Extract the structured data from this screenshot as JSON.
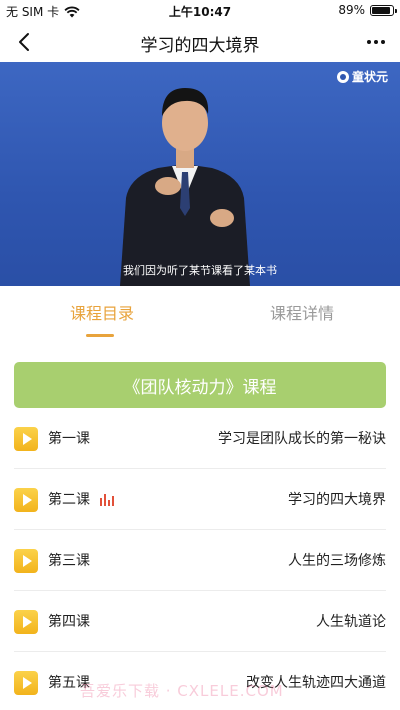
{
  "status_bar": {
    "carrier": "无 SIM 卡",
    "time": "上午10:47",
    "battery": "89%",
    "battery_level": 0.89
  },
  "nav": {
    "title": "学习的四大境界"
  },
  "video": {
    "logo_text": "童状元",
    "subtitle": "我们因为听了某节课看了某本书"
  },
  "tabs": {
    "catalog": "课程目录",
    "detail": "课程详情",
    "active": "catalog"
  },
  "course": {
    "title": "《团队核动力》课程"
  },
  "lessons": [
    {
      "num": "第一课",
      "title": "学习是团队成长的第一秘诀"
    },
    {
      "num": "第二课",
      "title": "学习的四大境界",
      "playing": true
    },
    {
      "num": "第三课",
      "title": "人生的三场修炼"
    },
    {
      "num": "第四课",
      "title": "人生轨道论"
    },
    {
      "num": "第五课",
      "title": "改变人生轨迹四大通道"
    }
  ],
  "watermark": "吾爱乐下载 · CXLELE.COM",
  "colors": {
    "accent": "#e8a33c",
    "banner": "#a8cf6f",
    "video_bg": "#2f56b0",
    "playing": "#e2513a"
  }
}
